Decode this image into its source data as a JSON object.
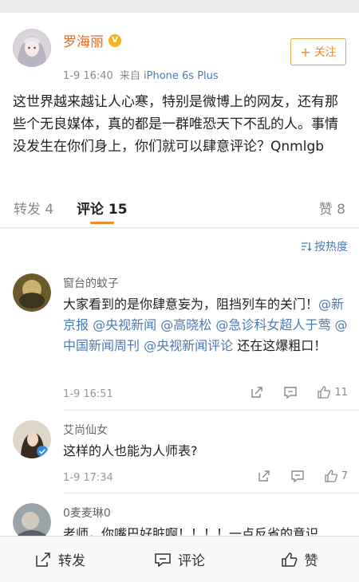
{
  "post": {
    "author": "罗海丽",
    "vip_badge": "V",
    "time": "1-9 16:40",
    "source_prefix": "来自",
    "device": "iPhone 6s Plus",
    "follow_label": "关注",
    "content": "这世界越来越让人心寒，特别是微博上的网友，还有那些个无良媒体，真的都是一群唯恐天下不乱的人。事情没发生在你们身上，你们就可以肆意评论？Qnmlgb"
  },
  "tabs": {
    "repost": "转发 4",
    "comment": "评论 15",
    "like": "赞 8"
  },
  "sort": {
    "label": "按热度"
  },
  "comments": [
    {
      "name": "窗台的蚊子",
      "text_parts": {
        "p1": "大家看到的是你肆意妄为，阻挡列车的关门！",
        "m1": "@新京报",
        "m2": "@央视新闻",
        "m3": "@高晓松",
        "m4": "@急诊科女超人于莺",
        "m5": "@中国新闻周刊",
        "m6": "@央视新闻评论",
        "p2": " 还在这爆粗口！"
      },
      "time": "1-9 16:51",
      "likes": "11"
    },
    {
      "name": "艾尚仙女",
      "text": "这样的人也能为人师表?",
      "time": "1-9 17:34",
      "likes": "7"
    },
    {
      "name": "0麦麦琳0",
      "text": "老师，你嘴巴好脏啊！！！！一点反省的意识"
    }
  ],
  "bottom_bar": {
    "repost": "转发",
    "comment": "评论",
    "like": "赞"
  },
  "colors": {
    "orange": "#f08a24",
    "link_blue": "#4d79b5"
  }
}
